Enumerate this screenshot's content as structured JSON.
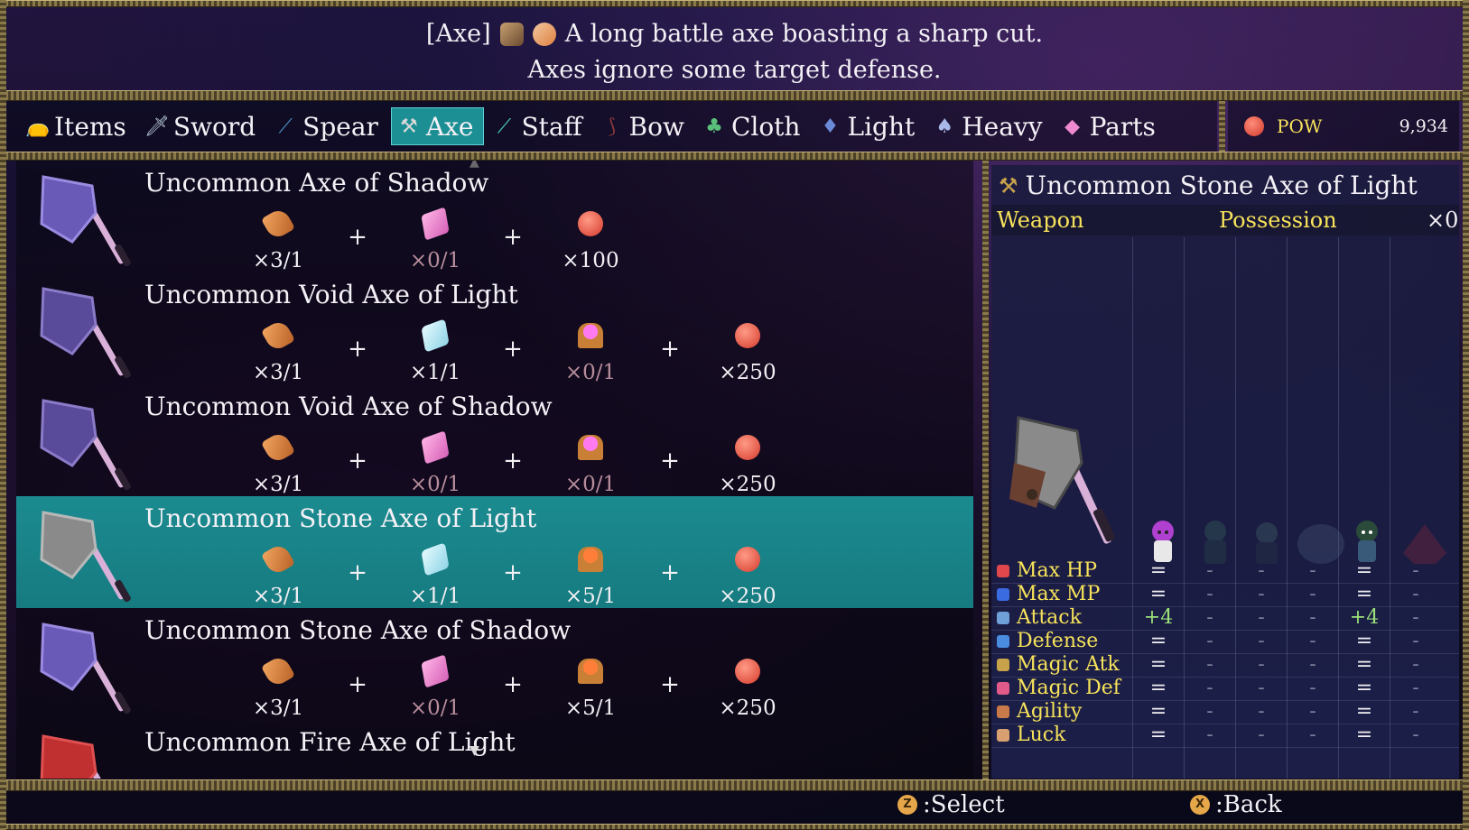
{
  "description": {
    "tag": "[Axe]",
    "line1": "A long battle axe boasting a sharp cut.",
    "line2": "Axes ignore some target defense."
  },
  "tabs": [
    {
      "label": "Items",
      "icon": "bag-icon"
    },
    {
      "label": "Sword",
      "icon": "sword-icon"
    },
    {
      "label": "Spear",
      "icon": "spear-icon"
    },
    {
      "label": "Axe",
      "icon": "axe-icon",
      "active": true
    },
    {
      "label": "Staff",
      "icon": "staff-icon"
    },
    {
      "label": "Bow",
      "icon": "bow-icon"
    },
    {
      "label": "Cloth",
      "icon": "cloth-icon"
    },
    {
      "label": "Light",
      "icon": "light-armor-icon"
    },
    {
      "label": "Heavy",
      "icon": "heavy-armor-icon"
    },
    {
      "label": "Parts",
      "icon": "parts-icon"
    }
  ],
  "currency": {
    "name": "POW",
    "amount": "9,934"
  },
  "recipes": [
    {
      "name": "Uncommon Axe of Shadow",
      "materials": [
        {
          "icon": "wood-icon",
          "qty": "×3/1"
        },
        {
          "icon": "pink-gem-icon",
          "qty": "×0/1",
          "lacking": true
        },
        {
          "icon": "pow-coin-icon",
          "qty": "×100"
        }
      ]
    },
    {
      "name": "Uncommon Void Axe of Light",
      "materials": [
        {
          "icon": "wood-icon",
          "qty": "×3/1"
        },
        {
          "icon": "ice-crystal-icon",
          "qty": "×1/1"
        },
        {
          "icon": "void-orb-icon",
          "qty": "×0/1",
          "lacking": true
        },
        {
          "icon": "pow-coin-icon",
          "qty": "×250"
        }
      ]
    },
    {
      "name": "Uncommon Void Axe of Shadow",
      "materials": [
        {
          "icon": "wood-icon",
          "qty": "×3/1"
        },
        {
          "icon": "pink-gem-icon",
          "qty": "×0/1",
          "lacking": true
        },
        {
          "icon": "void-orb-icon",
          "qty": "×0/1",
          "lacking": true
        },
        {
          "icon": "pow-coin-icon",
          "qty": "×250"
        }
      ]
    },
    {
      "name": "Uncommon Stone Axe of Light",
      "selected": true,
      "materials": [
        {
          "icon": "wood-icon",
          "qty": "×3/1"
        },
        {
          "icon": "ice-crystal-icon",
          "qty": "×1/1"
        },
        {
          "icon": "stone-orb-icon",
          "qty": "×5/1"
        },
        {
          "icon": "pow-coin-icon",
          "qty": "×250"
        }
      ]
    },
    {
      "name": "Uncommon Stone Axe of Shadow",
      "materials": [
        {
          "icon": "wood-icon",
          "qty": "×3/1"
        },
        {
          "icon": "pink-gem-icon",
          "qty": "×0/1",
          "lacking": true
        },
        {
          "icon": "stone-orb-icon",
          "qty": "×5/1"
        },
        {
          "icon": "pow-coin-icon",
          "qty": "×250"
        }
      ]
    },
    {
      "name": "Uncommon Fire Axe of Light",
      "materials": []
    }
  ],
  "detail": {
    "title": "Uncommon Stone Axe of Light",
    "type_label": "Weapon",
    "possession_label": "Possession",
    "possession_value": "×0",
    "stats": [
      {
        "name": "Max HP",
        "icon_color": "#e0474c",
        "values": [
          "=",
          "-",
          "-",
          "-",
          "=",
          "-"
        ]
      },
      {
        "name": "Max MP",
        "icon_color": "#3a6be0",
        "values": [
          "=",
          "-",
          "-",
          "-",
          "=",
          "-"
        ]
      },
      {
        "name": "Attack",
        "icon_color": "#6fa0d8",
        "values": [
          "+4",
          "-",
          "-",
          "-",
          "+4",
          "-"
        ]
      },
      {
        "name": "Defense",
        "icon_color": "#4a8de0",
        "values": [
          "=",
          "-",
          "-",
          "-",
          "=",
          "-"
        ]
      },
      {
        "name": "Magic Atk",
        "icon_color": "#c9a24c",
        "values": [
          "=",
          "-",
          "-",
          "-",
          "=",
          "-"
        ]
      },
      {
        "name": "Magic Def",
        "icon_color": "#e05a8a",
        "values": [
          "=",
          "-",
          "-",
          "-",
          "=",
          "-"
        ]
      },
      {
        "name": "Agility",
        "icon_color": "#c97a4a",
        "values": [
          "=",
          "-",
          "-",
          "-",
          "=",
          "-"
        ]
      },
      {
        "name": "Luck",
        "icon_color": "#d8a070",
        "values": [
          "=",
          "-",
          "-",
          "-",
          "=",
          "-"
        ]
      }
    ]
  },
  "footer": {
    "select_button": "Z",
    "select_label": ":Select",
    "back_button": "X",
    "back_label": ":Back"
  }
}
